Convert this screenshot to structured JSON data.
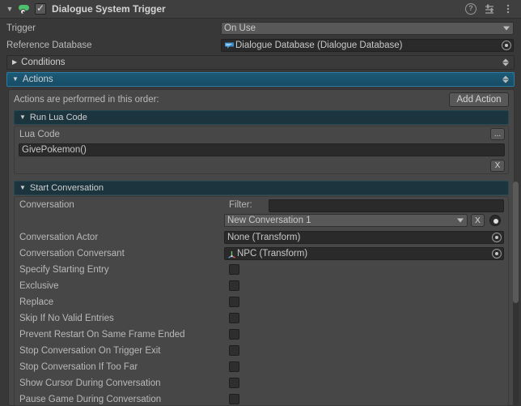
{
  "component": {
    "title": "Dialogue System Trigger",
    "enabled": true,
    "icon": "dialogue-system-trigger-icon",
    "foldout": "▼",
    "tools": {
      "help": "?",
      "preset": "preset-icon",
      "menu": "kebab-menu-icon"
    }
  },
  "properties": {
    "trigger": {
      "label": "Trigger",
      "value": "On Use"
    },
    "reference_database": {
      "label": "Reference Database",
      "value": "Dialogue Database (Dialogue Database)",
      "icon": "dialogue-database-icon"
    }
  },
  "sections": {
    "conditions": {
      "label": "Conditions",
      "expanded": false,
      "arrow": "▶"
    },
    "actions": {
      "label": "Actions",
      "expanded": true,
      "arrow": "▼",
      "hint": "Actions are performed in this order:",
      "add_button": "Add Action"
    }
  },
  "actions": [
    {
      "title": "Run Lua Code",
      "arrow": "▼",
      "lua": {
        "label": "Lua Code",
        "value": "GivePokemon()",
        "menu_button": "...",
        "remove_button": "X"
      }
    },
    {
      "title": "Start Conversation",
      "arrow": "▼",
      "conversation": {
        "label": "Conversation",
        "filter_label": "Filter:",
        "filter_value": "",
        "dropdown_value": "New Conversation 1",
        "clear_button": "X",
        "picker_button": "target-picker-icon"
      },
      "fields": [
        {
          "label": "Conversation Actor",
          "value": "None (Transform)",
          "icon": null
        },
        {
          "label": "Conversation Conversant",
          "value": "NPC (Transform)",
          "icon": "transform-icon"
        }
      ],
      "toggles": [
        {
          "label": "Specify Starting Entry",
          "checked": false
        },
        {
          "label": "Exclusive",
          "checked": false
        },
        {
          "label": "Replace",
          "checked": false
        },
        {
          "label": "Skip If No Valid Entries",
          "checked": false
        },
        {
          "label": "Prevent Restart On Same Frame Ended",
          "checked": false
        },
        {
          "label": "Stop Conversation On Trigger Exit",
          "checked": false
        },
        {
          "label": "Stop Conversation If Too Far",
          "checked": false
        },
        {
          "label": "Show Cursor During Conversation",
          "checked": false
        },
        {
          "label": "Pause Game During Conversation",
          "checked": false
        }
      ]
    }
  ],
  "colors": {
    "background": "#383838",
    "header": "#3f3f3f",
    "accent_selected": "#1b5a77",
    "accent_action": "#1c343d",
    "field": "#2a2a2a",
    "text": "#b9b9b9"
  }
}
